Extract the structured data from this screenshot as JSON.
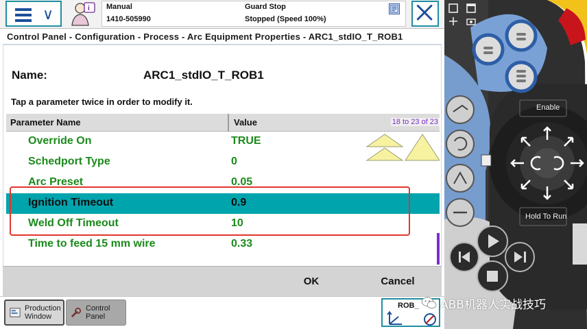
{
  "status": {
    "mode": "Manual",
    "serial": "1410-505990",
    "guard": "Guard Stop",
    "run_state": "Stopped (Speed 100%)"
  },
  "breadcrumb": "Control Panel - Configuration - Process - Arc Equipment Properties - ARC1_stdIO_T_ROB1",
  "name": {
    "label": "Name:",
    "value": "ARC1_stdIO_T_ROB1"
  },
  "instruction": "Tap a parameter twice in order to modify it.",
  "table": {
    "col_name": "Parameter Name",
    "col_value": "Value",
    "page_info": "18 to 23 of 23",
    "rows": [
      {
        "name": "Override On",
        "value": "TRUE"
      },
      {
        "name": "Schedport Type",
        "value": "0"
      },
      {
        "name": "Arc Preset",
        "value": "0.05"
      },
      {
        "name": "Ignition Timeout",
        "value": "0.9"
      },
      {
        "name": "Weld Off Timeout",
        "value": "10"
      },
      {
        "name": "Time to feed 15 mm wire",
        "value": "0.33"
      }
    ],
    "selected_row": "Ignition Timeout"
  },
  "actions": {
    "ok": "OK",
    "cancel": "Cancel"
  },
  "taskbar": {
    "production_window": "Production\nWindow",
    "control_panel": "Control\nPanel",
    "rob_label": "ROB_"
  },
  "pendant": {
    "enable_label": "Enable",
    "hold_label": "Hold To Run"
  },
  "watermark": "ABB机器人实战技巧",
  "colors": {
    "accent": "#1f8ea1",
    "selected_row": "#00a4ad",
    "param_text": "#1b8a1b",
    "highlight": "#e0362c",
    "page_info": "#7d2ec4"
  }
}
